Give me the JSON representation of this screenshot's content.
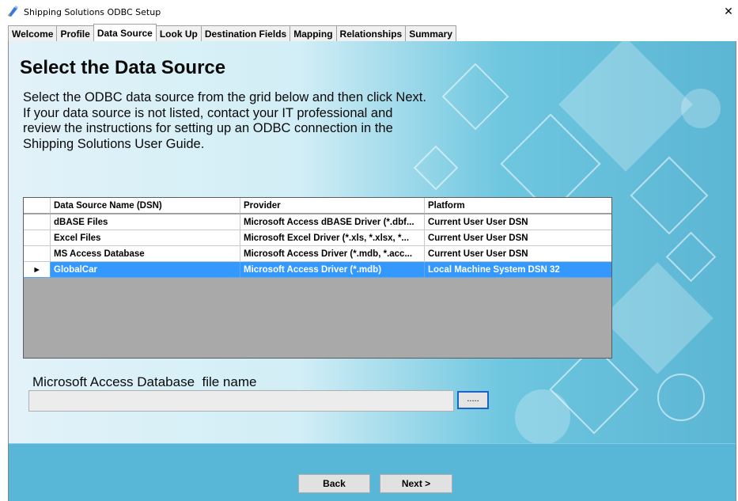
{
  "window": {
    "title": "Shipping Solutions ODBC Setup",
    "close_glyph": "✕",
    "icon": "odbc-app-icon"
  },
  "tabs": [
    {
      "label": "Welcome",
      "active": false
    },
    {
      "label": "Profile",
      "active": false
    },
    {
      "label": "Data Source",
      "active": true
    },
    {
      "label": "Look Up",
      "active": false
    },
    {
      "label": "Destination Fields",
      "active": false
    },
    {
      "label": "Mapping",
      "active": false
    },
    {
      "label": "Relationships",
      "active": false
    },
    {
      "label": "Summary",
      "active": false
    }
  ],
  "main": {
    "heading": "Select the Data Source",
    "instructions": [
      "Select the ODBC data source from the grid below and then click Next.",
      "If your data source is not listed, contact your IT professional and",
      "review the instructions for setting up an ODBC connection in the",
      "Shipping Solutions User Guide."
    ]
  },
  "grid": {
    "columns": [
      "",
      "Data Source Name (DSN)",
      "Provider",
      "Platform"
    ],
    "rows": [
      {
        "indicator": "",
        "dsn": "dBASE Files",
        "provider": "Microsoft Access dBASE Driver (*.dbf...",
        "platform": "Current User User DSN",
        "selected": false
      },
      {
        "indicator": "",
        "dsn": "Excel Files",
        "provider": "Microsoft Excel Driver (*.xls, *.xlsx, *...",
        "platform": "Current User User DSN",
        "selected": false
      },
      {
        "indicator": "",
        "dsn": "MS Access Database",
        "provider": "Microsoft Access Driver (*.mdb, *.acc...",
        "platform": "Current User User DSN",
        "selected": false
      },
      {
        "indicator": "▸",
        "dsn": "GlobalCar",
        "provider": "Microsoft Access Driver (*.mdb)",
        "platform": "Local Machine System DSN 32",
        "selected": true
      }
    ]
  },
  "file": {
    "label": "Microsoft Access Database  file name",
    "value": "",
    "browse_label": "....."
  },
  "nav": {
    "back_label": "Back",
    "next_label": "Next >"
  },
  "colors": {
    "selection": "#3399ff",
    "bottom_bar": "#58b7d6",
    "grid_empty": "#a9a9a9"
  }
}
